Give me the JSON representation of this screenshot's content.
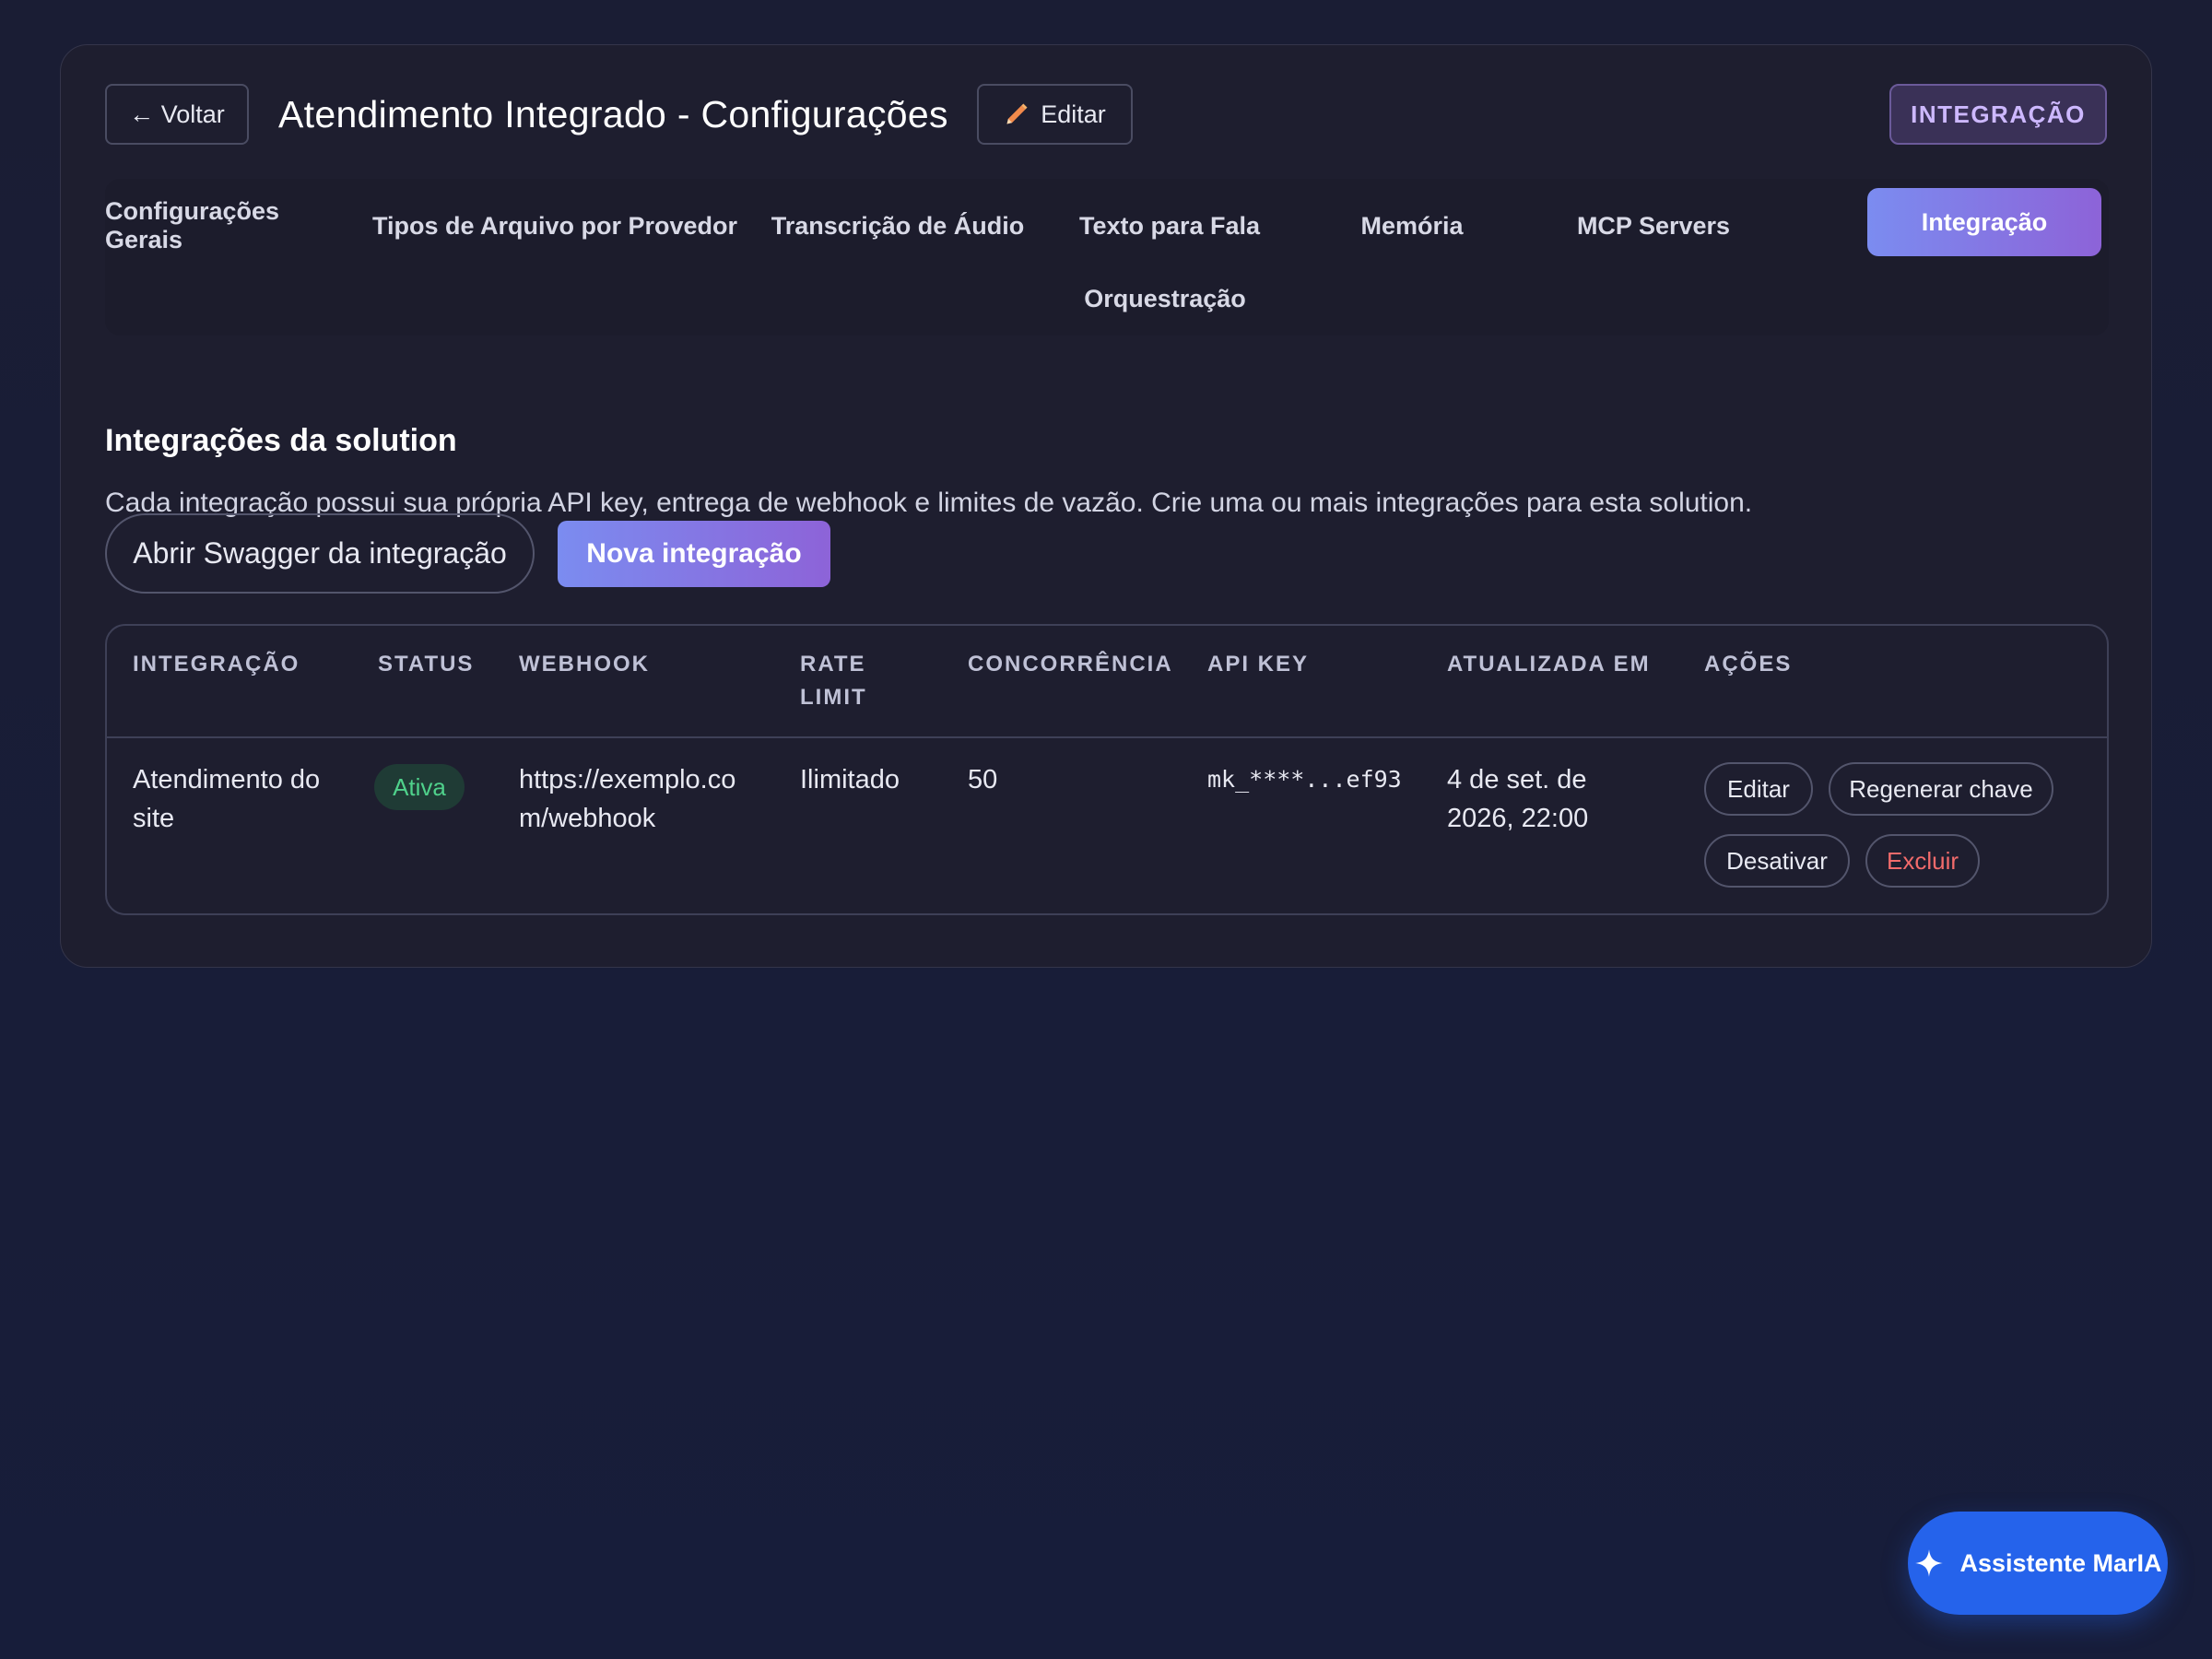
{
  "header": {
    "back_label": "← Voltar",
    "title": "Atendimento Integrado - Configurações",
    "edit_label": "Editar",
    "badge": "INTEGRAÇÃO"
  },
  "tabs": [
    {
      "label": "Configurações Gerais",
      "active": false
    },
    {
      "label": "Tipos de Arquivo por Provedor",
      "active": false
    },
    {
      "label": "Transcrição de Áudio",
      "active": false
    },
    {
      "label": "Texto para Fala",
      "active": false
    },
    {
      "label": "Memória",
      "active": false
    },
    {
      "label": "MCP Servers",
      "active": false
    },
    {
      "label": "Integração",
      "active": true
    },
    {
      "label": "Orquestração",
      "active": false
    }
  ],
  "section": {
    "title": "Integrações da solution",
    "description": "Cada integração possui sua própria API key, entrega de webhook e limites de vazão. Crie uma ou mais integrações para esta solution.",
    "swagger_label": "Abrir Swagger da integração",
    "new_label": "Nova integração"
  },
  "table": {
    "headers": {
      "integracao": "INTEGRAÇÃO",
      "status": "STATUS",
      "webhook": "WEBHOOK",
      "rate_limit_1": "RATE",
      "rate_limit_2": "LIMIT",
      "concorrencia": "CONCORRÊNCIA",
      "api_key": "API KEY",
      "atualizada": "ATUALIZADA EM",
      "acoes": "AÇÕES"
    },
    "rows": [
      {
        "integracao_1": "Atendimento do",
        "integracao_2": "site",
        "status": "Ativa",
        "webhook_1": "https://exemplo.co",
        "webhook_2": "m/webhook",
        "rate_limit": "Ilimitado",
        "concorrencia": "50",
        "api_key": "mk_****...ef93",
        "atualizada_1": "4 de set. de",
        "atualizada_2": "2026, 22:00",
        "actions": {
          "edit": "Editar",
          "regen": "Regenerar chave",
          "deactivate": "Desativar",
          "delete": "Excluir"
        }
      }
    ]
  },
  "assistant": {
    "label": "Assistente MarIA",
    "icon": "sparkle-icon"
  },
  "colors": {
    "accent_start": "#7b8cf0",
    "accent_end": "#8d63d8",
    "status_active": "#4fd18b",
    "danger": "#f26b6b",
    "assistant_blue": "#2563eb"
  }
}
